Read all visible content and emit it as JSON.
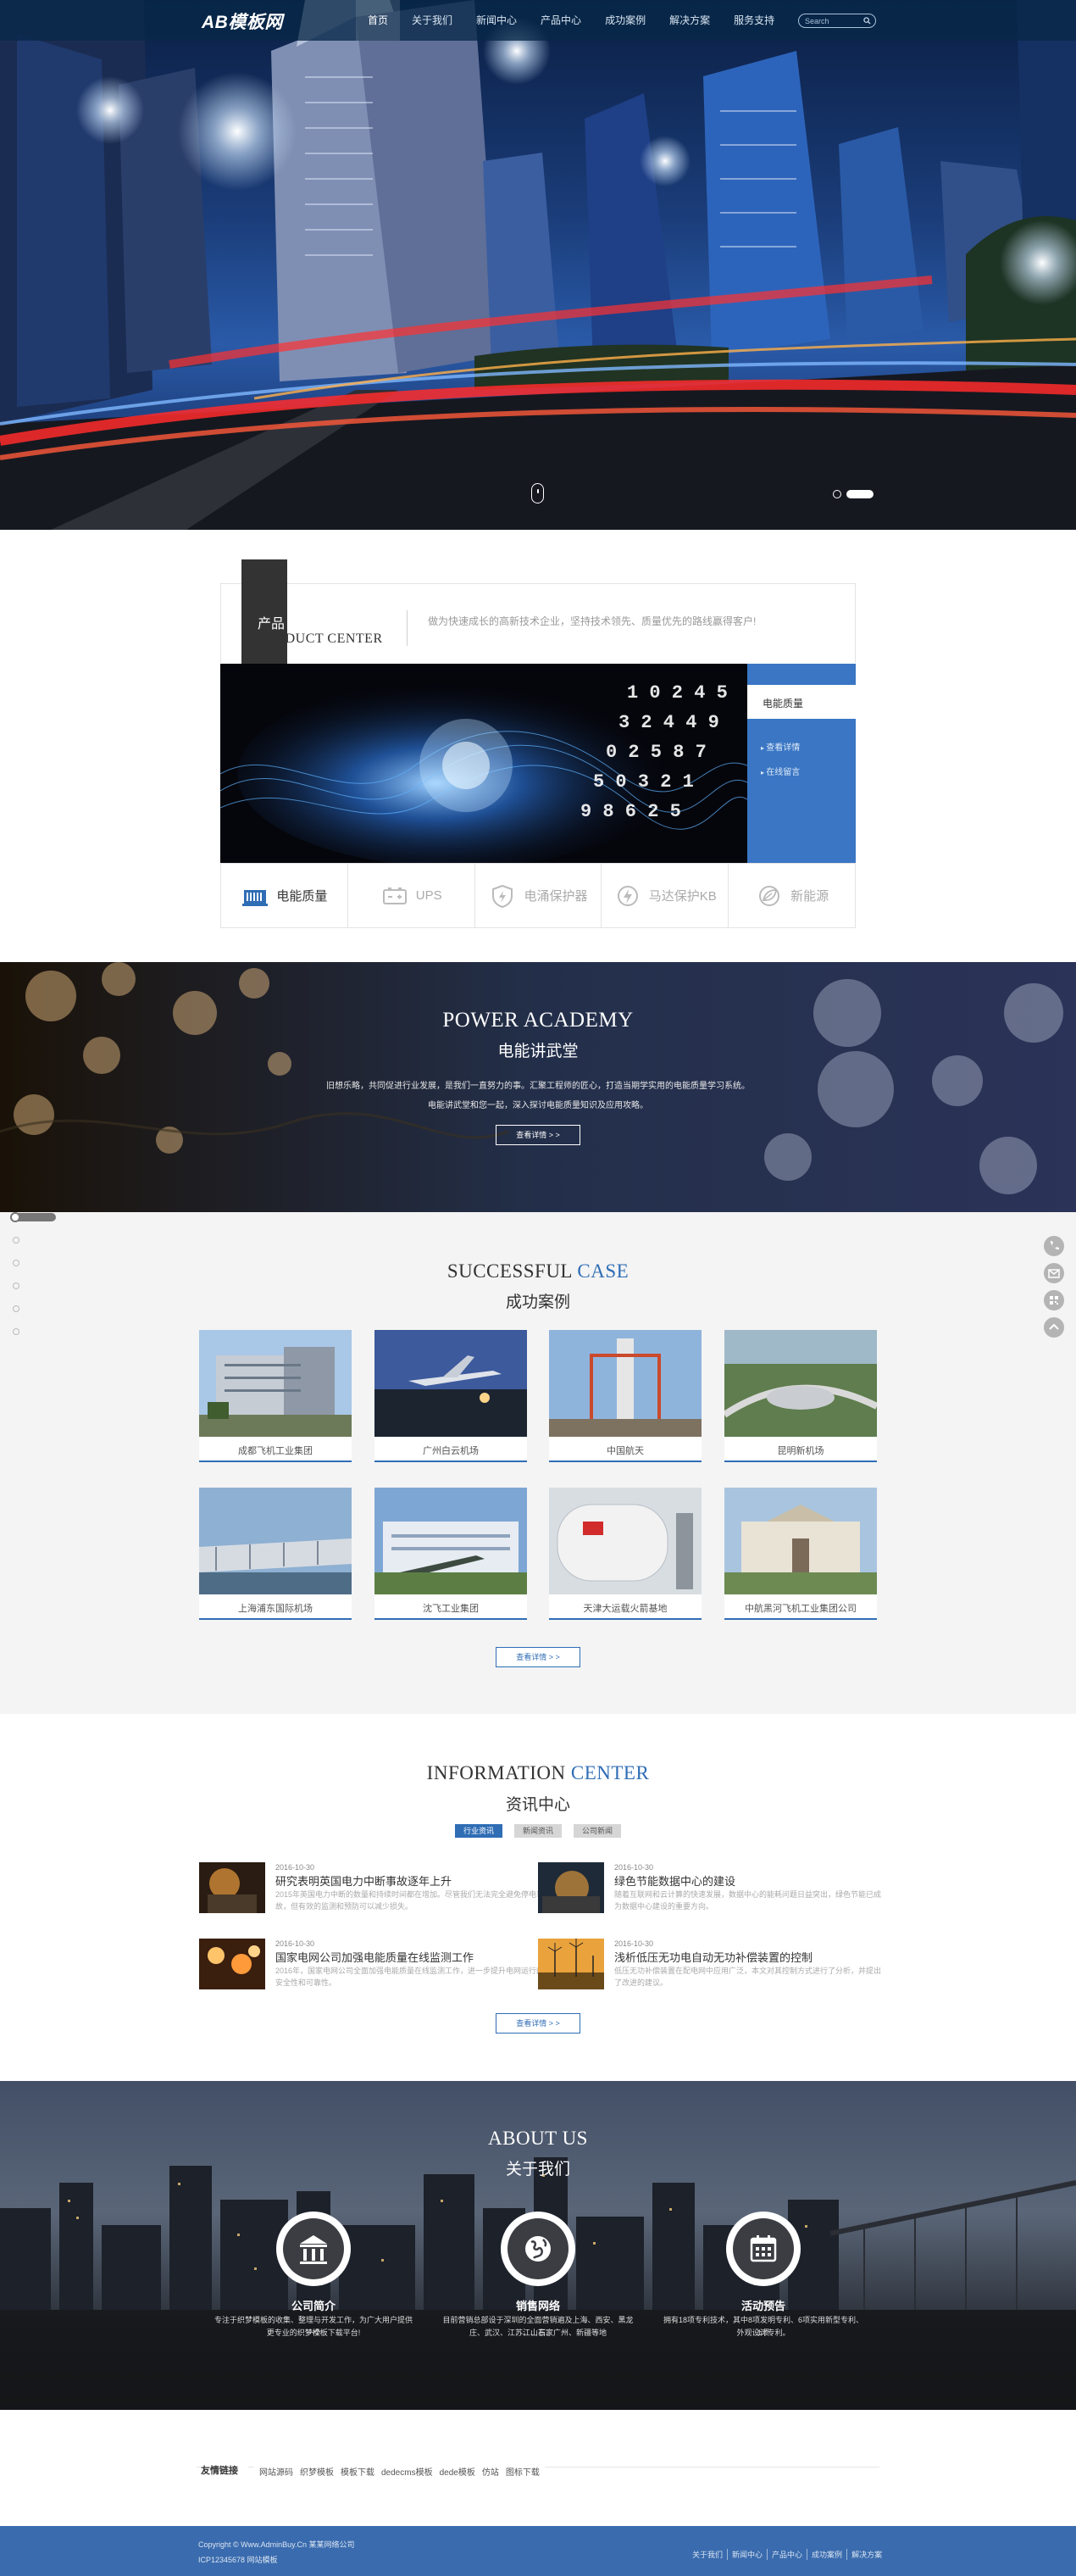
{
  "header": {
    "logo": "AB模板网",
    "nav": [
      "首页",
      "关于我们",
      "新闻中心",
      "产品中心",
      "成功案例",
      "解决方案",
      "服务支持"
    ],
    "search_placeholder": "Search"
  },
  "product_center": {
    "title_cn": "产品",
    "title_en": "PRODUCT CENTER",
    "description": "做为快速成长的高新技术企业，坚持技术领先、质量优先的路线赢得客户!",
    "side_title": "电能质量",
    "side_links": [
      "查看详情",
      "在线留言"
    ],
    "categories": [
      "电能质量",
      "UPS",
      "电涌保护器",
      "马达保护KB",
      "新能源"
    ]
  },
  "academy": {
    "title_en": "POWER ACADEMY",
    "title_cn": "电能讲武堂",
    "line1": "旧想乐略，共同促进行业发展，是我们一直努力的事。汇聚工程师的匠心，打造当期学实用的电能质量学习系统。",
    "line2": "电能讲武堂和您一起，深入探讨电能质量知识及应用攻略。",
    "button": "查看详情 > >"
  },
  "cases": {
    "title_en_a": "SUCCESSFUL",
    "title_en_b": "CASE",
    "title_cn": "成功案例",
    "items": [
      "成都飞机工业集团",
      "广州白云机场",
      "中国航天",
      "昆明新机场",
      "上海浦东国际机场",
      "沈飞工业集团",
      "天津大运载火箭基地",
      "中航黑河飞机工业集团公司"
    ],
    "button": "查看详情 > >"
  },
  "news": {
    "title_en_a": "INFORMATION",
    "title_en_b": "CENTER",
    "title_cn": "资讯中心",
    "tabs": [
      "行业资讯",
      "新闻资讯",
      "公司新闻"
    ],
    "items": [
      {
        "date": "2016-10-30",
        "title": "研究表明英国电力中断事故逐年上升",
        "summary": "2015年英国电力中断的数量和持续时间都在增加。尽管我们无法完全避免停电事故，但有效的监测和预防可以减少损失。"
      },
      {
        "date": "2016-10-30",
        "title": "绿色节能数据中心的建设",
        "summary": "随着互联网和云计算的快速发展，数据中心的能耗问题日益突出，绿色节能已成为数据中心建设的重要方向。"
      },
      {
        "date": "2016-10-30",
        "title": "国家电网公司加强电能质量在线监测工作",
        "summary": "2016年，国家电网公司全面加强电能质量在线监测工作，进一步提升电网运行的安全性和可靠性。"
      },
      {
        "date": "2016-10-30",
        "title": "浅析低压无功电自动无功补偿装置的控制",
        "summary": "低压无功补偿装置在配电网中应用广泛，本文对其控制方式进行了分析，并提出了改进的建议。"
      }
    ],
    "button": "查看详情 > >"
  },
  "about": {
    "title_en": "ABOUT US",
    "title_cn": "关于我们",
    "items": [
      {
        "title": "公司简介",
        "line1": "专注于织梦模板的收集、整理与开发工作，为广大用户提供一个",
        "line2": "更专业的织梦模板下载平台!"
      },
      {
        "title": "销售网络",
        "line1": "目前营销总部设于深圳的全面营销遍及上海、西安、黑龙江、石家",
        "line2": "庄、武汉、江苏、山东、广州、新疆等地"
      },
      {
        "title": "活动预告",
        "line1": "拥有18项专利技术，其中8项发明专利、6项实用新型专利、1项",
        "line2": "外观设计专利。"
      }
    ]
  },
  "links": {
    "title": "友情链接",
    "items": [
      "网站源码",
      "织梦模板",
      "模板下载",
      "dedecms模板",
      "dede模板",
      "仿站",
      "图标下载"
    ]
  },
  "footer": {
    "copyright": "Copyright © Www.AdminBuy.Cn 某某网络公司",
    "icp": "ICP12345678 网站模板",
    "nav": [
      "关于我们",
      "新闻中心",
      "产品中心",
      "成功案例",
      "解决方案"
    ]
  },
  "colors": {
    "accent": "#2f6db5",
    "header": "#082848",
    "footer": "#3a6bae"
  }
}
